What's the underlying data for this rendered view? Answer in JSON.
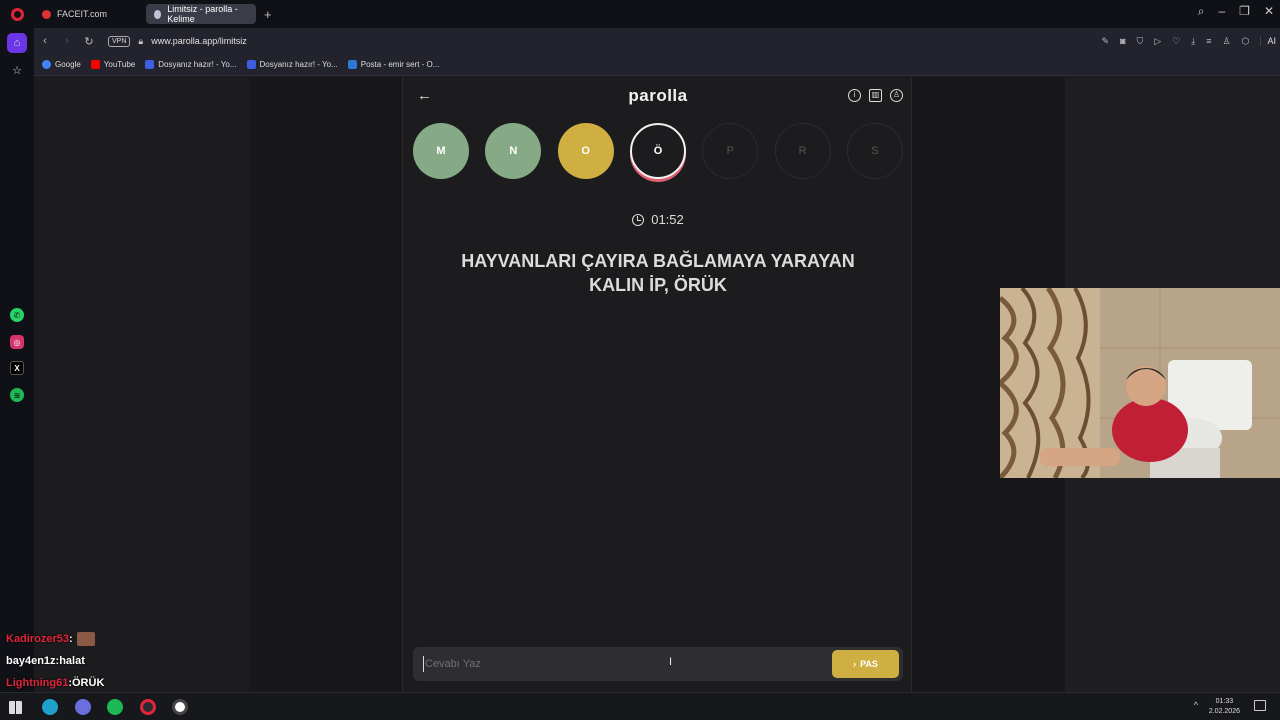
{
  "browser": {
    "tabs": [
      {
        "label": "FACEIT.com",
        "active": false
      },
      {
        "label": "Limitsiz - parolla - Kelime",
        "active": true
      }
    ],
    "new_tab": "+",
    "url": "www.parolla.app/limitsiz",
    "vpn_label": "VPN",
    "ai_label": "AI",
    "bookmarks": [
      {
        "label": "Google",
        "color": "#4285f4"
      },
      {
        "label": "YouTube",
        "color": "#ff0000"
      },
      {
        "label": "Dosyanız hazır! - Yo...",
        "color": "#3b5fe0"
      },
      {
        "label": "Dosyanız hazır! - Yo...",
        "color": "#3b5fe0"
      },
      {
        "label": "Posta - emir sert - O...",
        "color": "#2d7ad6"
      }
    ]
  },
  "app": {
    "logo": "parolla",
    "letters": [
      {
        "letter": "M",
        "state": "correct"
      },
      {
        "letter": "N",
        "state": "correct"
      },
      {
        "letter": "O",
        "state": "passed"
      },
      {
        "letter": "Ö",
        "state": "current"
      },
      {
        "letter": "P",
        "state": "pending"
      },
      {
        "letter": "R",
        "state": "pending"
      },
      {
        "letter": "S",
        "state": "pending"
      }
    ],
    "timer": "01:52",
    "question": "HAYVANLARI ÇAYIRA BAĞLAMAYA YARAYAN KALIN İP, ÖRÜK",
    "answer_placeholder": "Cevabı Yaz",
    "pas_label": "PAS"
  },
  "chat": [
    {
      "user": "Kadirozer53",
      "sep": " :",
      "message": "",
      "emote": true,
      "user_color": "red"
    },
    {
      "user": "bay4en1z",
      "sep": " :",
      "message": " halat",
      "emote": false,
      "user_color": "white"
    },
    {
      "user": "Lightning61",
      "sep": " :",
      "message": " ÖRÜK",
      "emote": false,
      "user_color": "red"
    }
  ],
  "taskbar": {
    "time": "01:33",
    "date": "2.02.2026"
  },
  "colors": {
    "correct": "#87aa86",
    "passed": "#cfaf42",
    "accent_purple": "#6b35e8"
  }
}
